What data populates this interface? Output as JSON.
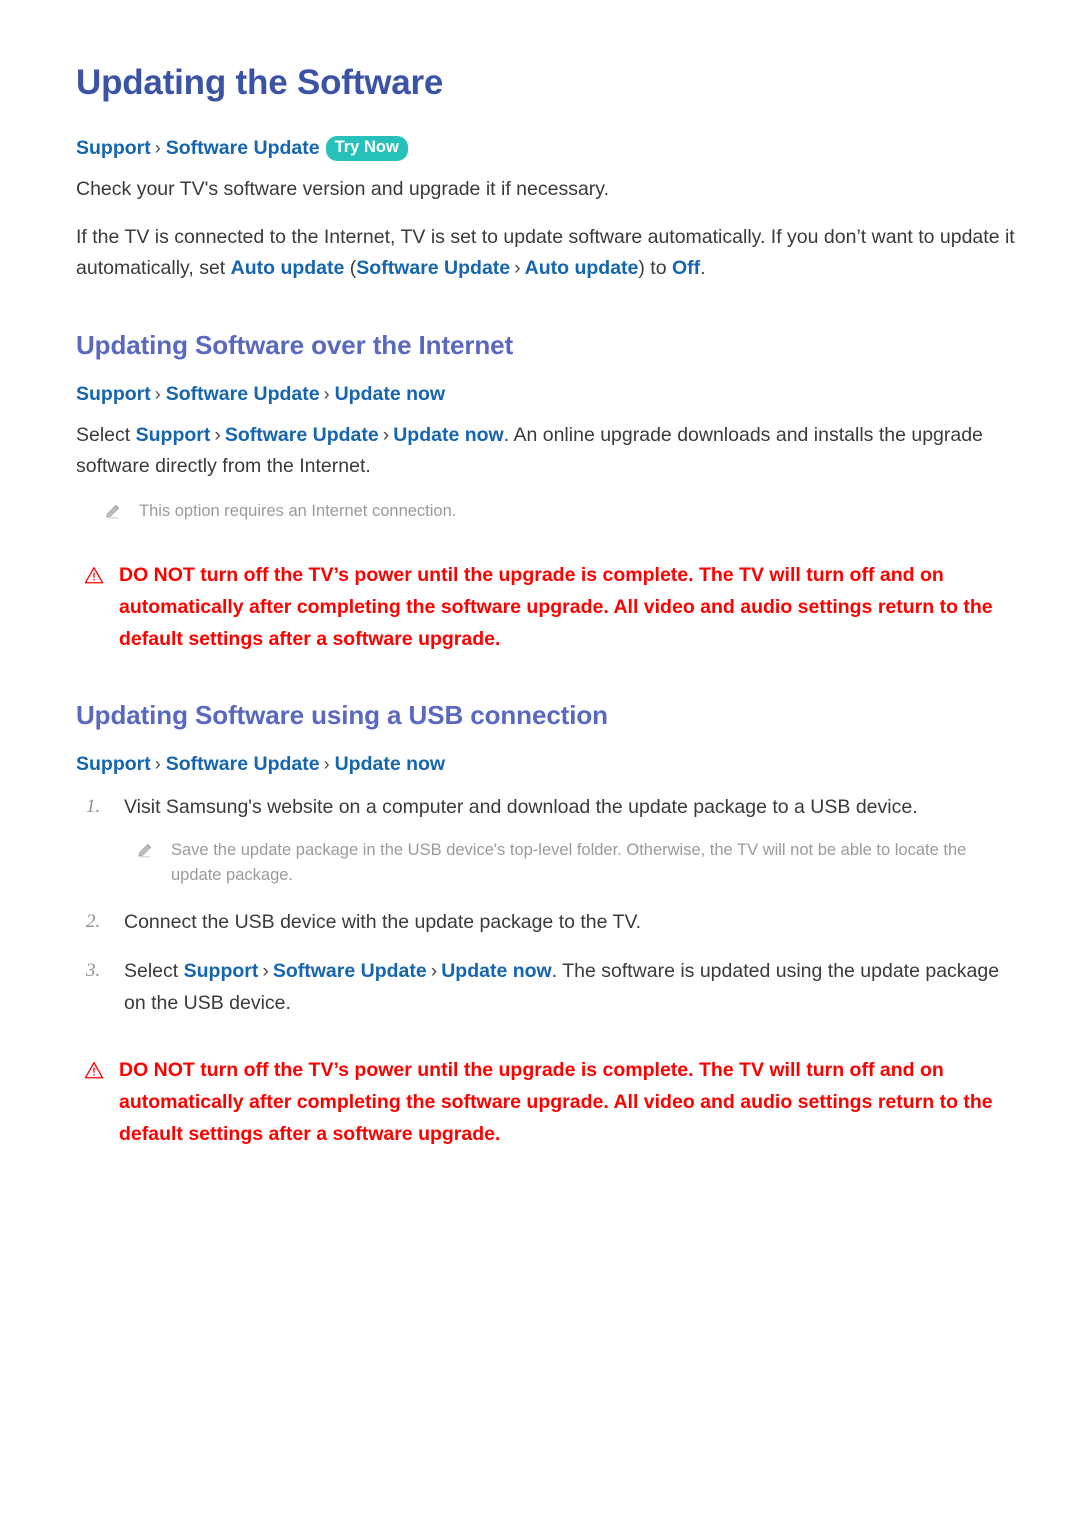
{
  "page": {
    "title": "Updating the Software"
  },
  "intro": {
    "breadcrumb": {
      "crumb1": "Support",
      "sep": "›",
      "crumb2": "Software Update",
      "badge": "Try Now"
    },
    "paragraph1": "Check your TV's software version and upgrade it if necessary.",
    "paragraph2": {
      "part1": "If the TV is connected to the Internet, TV is set to update software automatically. If you don’t want to update it automatically, set ",
      "link1": "Auto update",
      "part2": " (",
      "link2": "Software Update",
      "sep": "›",
      "link3": "Auto update",
      "part3": ") to ",
      "link4": "Off",
      "part4": "."
    }
  },
  "section_internet": {
    "heading": "Updating Software over the Internet",
    "breadcrumb": {
      "crumb1": "Support",
      "sep1": "›",
      "crumb2": "Software Update",
      "sep2": "›",
      "crumb3": "Update now"
    },
    "paragraph": {
      "part1": "Select ",
      "link1": "Support",
      "sep1": "›",
      "link2": "Software Update",
      "sep2": "›",
      "link3": "Update now",
      "part2": ". An online upgrade downloads and installs the upgrade software directly from the Internet."
    },
    "note": "This option requires an Internet connection.",
    "warning": "DO NOT turn off the TV’s power until the upgrade is complete. The TV will turn off and on automatically after completing the software upgrade. All video and audio settings return to the default settings after a software upgrade."
  },
  "section_usb": {
    "heading": "Updating Software using a USB connection",
    "breadcrumb": {
      "crumb1": "Support",
      "sep1": "›",
      "crumb2": "Software Update",
      "sep2": "›",
      "crumb3": "Update now"
    },
    "steps": [
      {
        "num": "1.",
        "text": "Visit Samsung's website on a computer and download the update package to a USB device."
      },
      {
        "num": "2.",
        "text": "Connect the USB device with the update package to the TV."
      },
      {
        "num": "3.",
        "text": ""
      }
    ],
    "step1_note": "Save the update package in the USB device's top-level folder. Otherwise, the TV will not be able to locate the update package.",
    "step3": {
      "part1": "Select ",
      "link1": "Support",
      "sep1": "›",
      "link2": "Software Update",
      "sep2": "›",
      "link3": "Update now",
      "part2": ". The software is updated using the update package on the USB device."
    },
    "warning": "DO NOT turn off the TV’s power until the upgrade is complete. The TV will turn off and on automatically after completing the software upgrade. All video and audio settings return to the default settings after a software upgrade."
  },
  "colors": {
    "title_blue": "#3a53a4",
    "heading_purple": "#5a68c0",
    "link_blue": "#1565b0",
    "badge_teal": "#26c2b9",
    "warning_red": "#ff0000",
    "note_gray": "#9a9a9a",
    "body_text": "#3a3a3a"
  }
}
